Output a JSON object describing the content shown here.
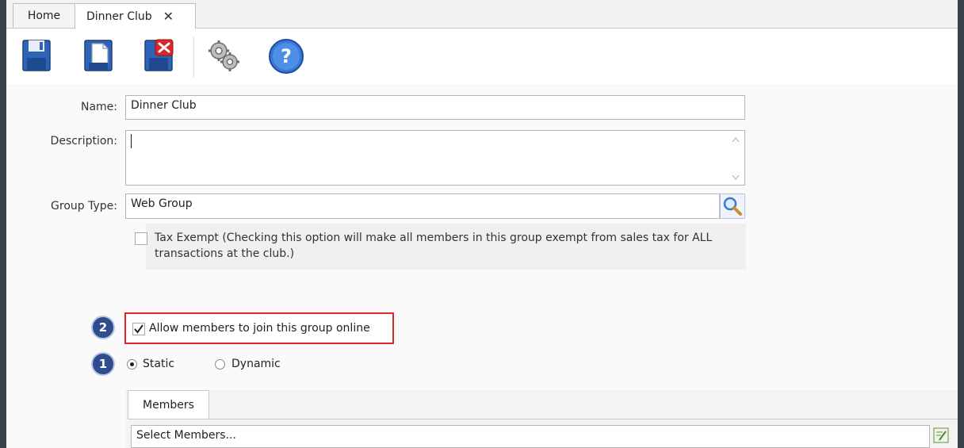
{
  "tabs": [
    {
      "label": "Home"
    },
    {
      "label": "Dinner Club",
      "close": "✕"
    }
  ],
  "toolbar": {
    "buttons": [
      "save-icon",
      "save-new-icon",
      "save-close-icon",
      "settings-icon",
      "help-icon"
    ],
    "help_glyph": "?"
  },
  "form": {
    "name_label": "Name:",
    "name_value": "Dinner Club",
    "description_label": "Description:",
    "description_value": "",
    "group_type_label": "Group Type:",
    "group_type_value": "Web Group",
    "tax_exempt_text": "Tax Exempt (Checking this option will make all members in this group exempt from sales tax for ALL transactions at the club.)",
    "allow_online_label": "Allow members to join this group online",
    "allow_online_checked": true,
    "radio_static": "Static",
    "radio_dynamic": "Dynamic",
    "badge_1": "1",
    "badge_2": "2"
  },
  "members": {
    "tab_label": "Members",
    "select_placeholder": "Select Members..."
  }
}
